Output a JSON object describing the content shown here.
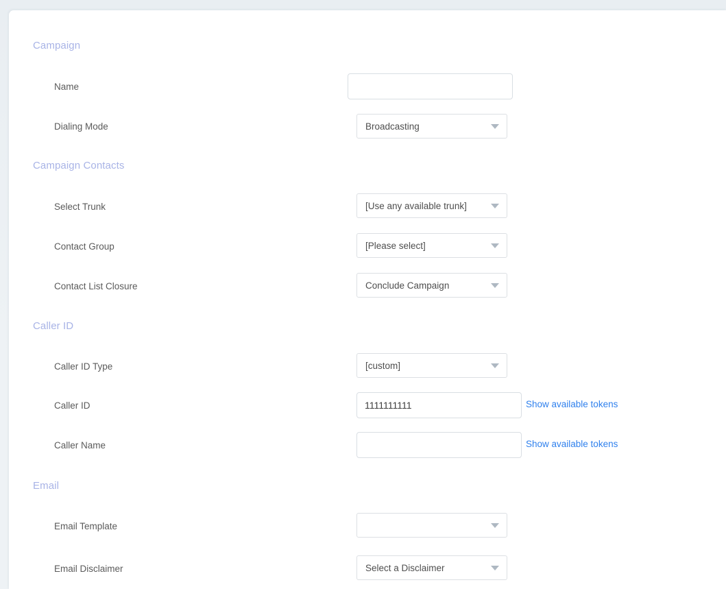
{
  "theme": {
    "page_background": "#eef2f5",
    "card_background": "#ffffff",
    "section_heading_color": "#a8b3e6",
    "label_color": "#5a5a5a",
    "link_color": "#2f80ed",
    "input_border_color": "#d9dee3",
    "dropdown_arrow_color": "#aeb8c2"
  },
  "sections": [
    {
      "id": "campaign",
      "title": "Campaign",
      "fields": [
        {
          "id": "name",
          "label": "Name",
          "type": "text",
          "value": "",
          "placeholder": ""
        },
        {
          "id": "dialing-mode",
          "label": "Dialing Mode",
          "type": "select",
          "value": "Broadcasting"
        }
      ]
    },
    {
      "id": "campaign-contacts",
      "title": "Campaign Contacts",
      "fields": [
        {
          "id": "select-trunk",
          "label": "Select Trunk",
          "type": "select",
          "value": "[Use any available trunk]"
        },
        {
          "id": "contact-group",
          "label": "Contact Group",
          "type": "select",
          "value": "[Please select]"
        },
        {
          "id": "contact-list-closure",
          "label": "Contact List Closure",
          "type": "select",
          "value": "Conclude Campaign"
        }
      ]
    },
    {
      "id": "caller-id",
      "title": "Caller ID",
      "fields": [
        {
          "id": "caller-id-type",
          "label": "Caller ID Type",
          "type": "select",
          "value": "[custom]"
        },
        {
          "id": "caller-id",
          "label": "Caller ID",
          "type": "text",
          "value": "1111111111",
          "placeholder": "",
          "link": "Show available tokens"
        },
        {
          "id": "caller-name",
          "label": "Caller Name",
          "type": "text",
          "value": "",
          "placeholder": "",
          "link": "Show available tokens"
        }
      ]
    },
    {
      "id": "email",
      "title": "Email",
      "fields": [
        {
          "id": "email-template",
          "label": "Email Template",
          "type": "select",
          "value": ""
        },
        {
          "id": "email-disclaimer",
          "label": "Email Disclaimer",
          "type": "select",
          "value": "Select a Disclaimer"
        }
      ]
    }
  ],
  "layout": {
    "section_tops": [
      42,
      217,
      451,
      684
    ],
    "row_tops": {
      "name": 92,
      "dialing-mode": 150,
      "select-trunk": 267,
      "contact-group": 325,
      "contact-list-closure": 383,
      "caller-id-type": 500,
      "caller-id": 557,
      "caller-name": 615,
      "email-template": 733,
      "email-disclaimer": 795
    },
    "control_offsets": {
      "name": 0,
      "dialing-mode": 1,
      "select-trunk": 0,
      "contact-group": 0,
      "contact-list-closure": 0,
      "caller-id-type": 0,
      "caller-id": 1,
      "caller-name": 1,
      "email-template": 0,
      "email-disclaimer": 0
    },
    "link_tops": {
      "caller-id": 559,
      "caller-name": 617
    }
  }
}
